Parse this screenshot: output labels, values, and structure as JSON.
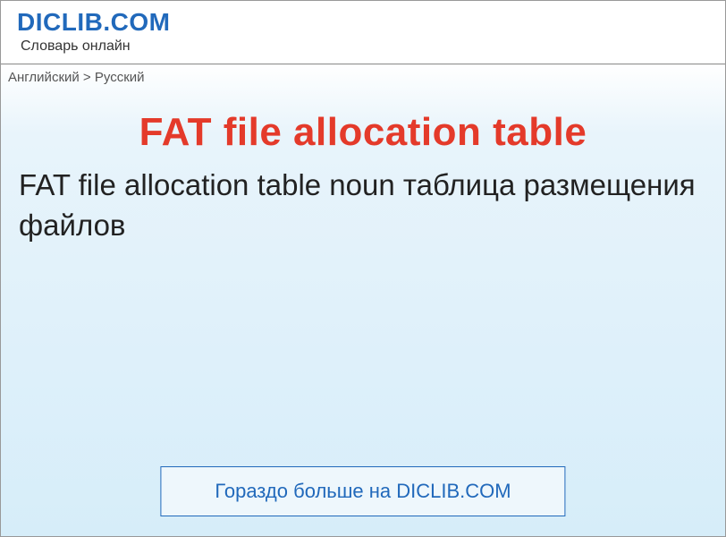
{
  "header": {
    "site_title": "DICLIB.COM",
    "site_subtitle": "Словарь онлайн"
  },
  "breadcrumb": {
    "text": "Английский > Русский"
  },
  "entry": {
    "title": "FAT file allocation table",
    "definition": "FAT file allocation table noun таблица размещения файлов"
  },
  "footer": {
    "link_text": "Гораздо больше на DICLIB.COM"
  }
}
